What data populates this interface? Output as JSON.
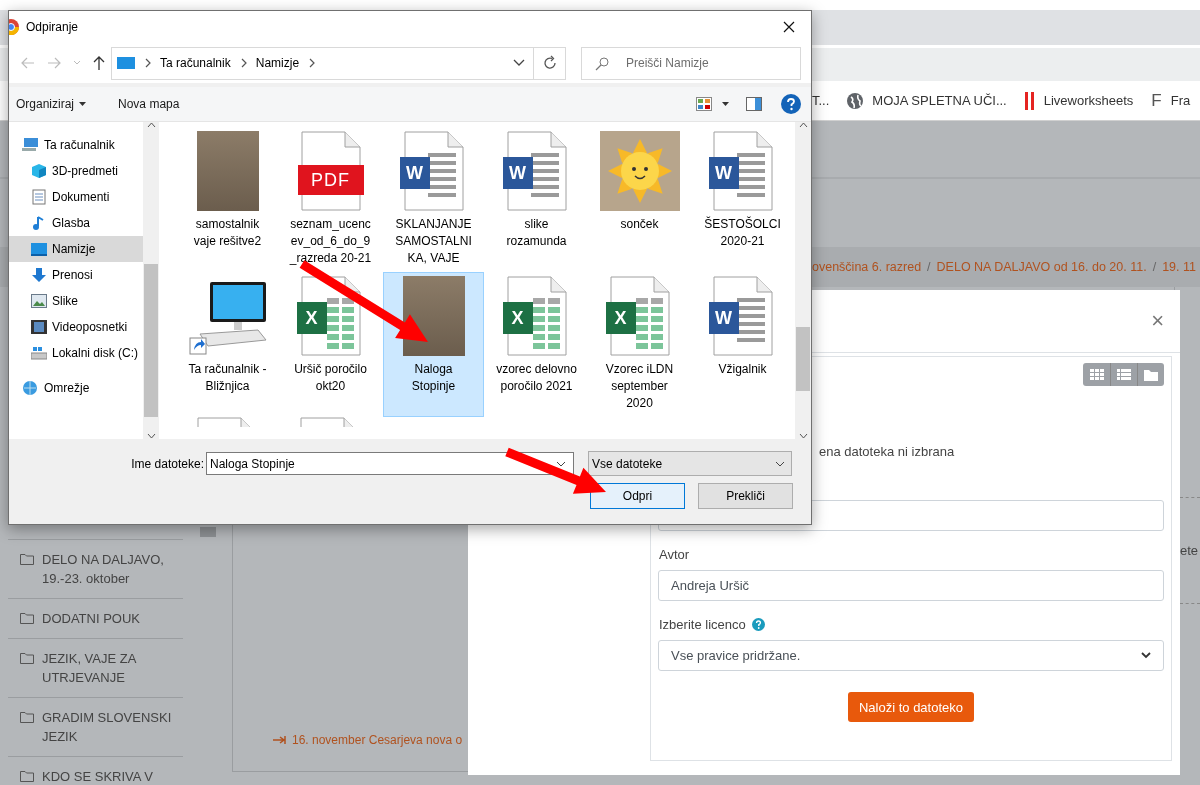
{
  "browser": {
    "bookmarks": [
      {
        "kind": "plain",
        "label": "T..."
      },
      {
        "kind": "globe",
        "label": "MOJA SPLETNA UČI..."
      },
      {
        "kind": "bars",
        "label": "Liveworksheets"
      },
      {
        "kind": "letter",
        "icon_text": "F",
        "label": "Fra"
      }
    ]
  },
  "breadcrumb": [
    {
      "kind": "link",
      "text": "ovenščina 6. razred"
    },
    {
      "kind": "separator",
      "text": "/"
    },
    {
      "kind": "link",
      "text": "DELO NA DALJAVO od 16. do 20. 11."
    },
    {
      "kind": "separator",
      "text": "/"
    },
    {
      "kind": "link",
      "text": "19. 11"
    }
  ],
  "course_sidebar": [
    "DELO NA DALJAVO, 19.-23. oktober",
    "DODATNI POUK",
    "JEZIK, VAJE ZA UTRJEVANJE",
    "GRADIM SLOVENSKI JEZIK",
    "KDO SE SKRIVA V"
  ],
  "content_link": "16. november Cesarjeva nova o",
  "right_edge_text": "ete",
  "upload_modal": {
    "close": "×",
    "view_buttons": [
      {
        "kind": "icons"
      },
      {
        "kind": "list"
      },
      {
        "kind": "tree"
      }
    ],
    "no_file_text": "ena datoteka ni izbrana",
    "author_label": "Avtor",
    "author_value": "Andreja Uršič",
    "license_label": "Izberite licenco",
    "license_value": "Vse pravice pridržane.",
    "upload_button": "Naloži to datoteko"
  },
  "file_dialog": {
    "title": "Odpiranje",
    "address": [
      "Ta računalnik",
      "Namizje"
    ],
    "search_placeholder": "Preišči Namizje",
    "organize": "Organiziraj",
    "new_folder": "Nova mapa",
    "nav": [
      {
        "kind": "pc",
        "label": "Ta računalnik",
        "selected": false,
        "children": [
          {
            "kind": "cube",
            "label": "3D-predmeti",
            "selected": false
          },
          {
            "kind": "doc",
            "label": "Dokumenti",
            "selected": false
          },
          {
            "kind": "music",
            "label": "Glasba",
            "selected": false
          },
          {
            "kind": "desktop",
            "label": "Namizje",
            "selected": true
          },
          {
            "kind": "download",
            "label": "Prenosi",
            "selected": false
          },
          {
            "kind": "picture",
            "label": "Slike",
            "selected": false
          },
          {
            "kind": "film",
            "label": "Videoposnetki",
            "selected": false
          },
          {
            "kind": "drive",
            "label": "Lokalni disk (C:)",
            "selected": false
          }
        ]
      },
      {
        "kind": "network",
        "label": "Omrežje",
        "selected": false
      }
    ],
    "files": [
      {
        "kind": "scan",
        "label": "samostalnik vaje rešitve2",
        "selected": false
      },
      {
        "kind": "pdf",
        "badge": "PDF",
        "label": "seznam_ucencev_od_6_do_9_razreda 20-21",
        "selected": false
      },
      {
        "kind": "word",
        "badge": "W",
        "label": "SKLANJANJE SAMOSTALNIKA, VAJE",
        "selected": false
      },
      {
        "kind": "word",
        "badge": "W",
        "label": "slike rozamunda",
        "selected": false
      },
      {
        "kind": "image",
        "label": "sonček",
        "selected": false
      },
      {
        "kind": "word",
        "badge": "W",
        "label": "ŠESTOŠOLCI 2020-21",
        "selected": false
      },
      {
        "kind": "shortcut",
        "label": "Ta računalnik - Bližnjica",
        "selected": false
      },
      {
        "kind": "excel",
        "badge": "X",
        "label": "Uršič poročilo okt20",
        "selected": false
      },
      {
        "kind": "scan",
        "label": "Naloga Stopinje",
        "selected": true
      },
      {
        "kind": "excel",
        "badge": "X",
        "label": "vzorec delovno poročilo 2021",
        "selected": false
      },
      {
        "kind": "excel",
        "badge": "X",
        "label": "Vzorec iLDN september 2020",
        "selected": false
      },
      {
        "kind": "word",
        "badge": "W",
        "label": "Vžigalnik",
        "selected": false
      }
    ],
    "filename_label": "Ime datoteke:",
    "filename_value": "Naloga Stopinje",
    "filter": "Vse datoteke",
    "buttons": [
      {
        "label": "Odpri",
        "default": true
      },
      {
        "label": "Prekliči",
        "default": false
      }
    ]
  }
}
